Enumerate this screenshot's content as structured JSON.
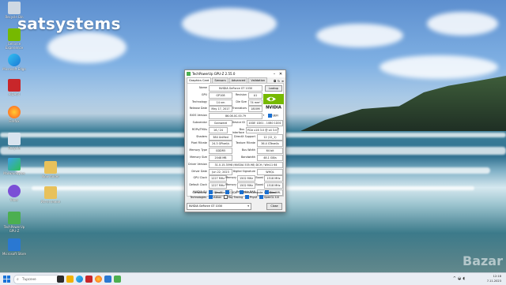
{
  "watermark": "satsystems",
  "brand_logo": "Bazar",
  "desktop_icons": [
    {
      "label": "Recycle Bin",
      "icon": "recycle-bin-icon"
    },
    {
      "label": "GeForce Experience",
      "icon": "nvidia-icon"
    },
    {
      "label": "Microsoft Edge",
      "icon": "edge-icon"
    },
    {
      "label": "AIDA64",
      "icon": "aida64-icon"
    },
    {
      "label": "Firefox",
      "icon": "firefox-icon"
    },
    {
      "label": "Recycle",
      "icon": "app-icon"
    },
    {
      "label": "Malwarebytes",
      "icon": "malwarebytes-icon"
    },
    {
      "label": "Viber",
      "icon": "viber-icon"
    },
    {
      "label": "Skype",
      "icon": "skype-icon"
    },
    {
      "label": "TechPowerUp GPU-Z",
      "icon": "gpuz-icon"
    },
    {
      "label": "Microsoft Store",
      "icon": "store-icon"
    }
  ],
  "desktop_folders": [
    {
      "label": "New folder"
    },
    {
      "label": "Изтегляния"
    }
  ],
  "gpuz": {
    "title": "TechPowerUp GPU-Z 2.55.0",
    "tabs": [
      "Graphics Card",
      "Sensors",
      "Advanced",
      "Validation"
    ],
    "lookup_label": "Lookup",
    "rows": [
      {
        "label": "Name",
        "values": [
          "NVIDIA GeForce GT 1030"
        ]
      },
      {
        "label": "GPU",
        "values": [
          "GP108",
          "Revision",
          "A1"
        ]
      },
      {
        "label": "Technology",
        "values": [
          "14 nm",
          "Die Size",
          "74 mm²"
        ]
      },
      {
        "label": "Release Date",
        "values": [
          "May 17, 2017",
          "Transistors",
          "1800M"
        ]
      },
      {
        "label": "BIOS Version",
        "values": [
          "86.08.0C.00.79",
          "UEFI"
        ]
      },
      {
        "label": "Subvendor",
        "values": [
          "Gainward",
          "Device ID",
          "10DE 1D01 - 10B0 1D01"
        ]
      },
      {
        "label": "ROPs/TMUs",
        "values": [
          "16 / 24",
          "Bus Interface",
          "PCIe x16 3.0 @ x4 3.0"
        ]
      },
      {
        "label": "Shaders",
        "values": [
          "384 Unified",
          "DirectX Support",
          "12 (12_1)"
        ]
      },
      {
        "label": "Pixel Fillrate",
        "values": [
          "24.3 GPixel/s",
          "Texture Fillrate",
          "36.4 GTexel/s"
        ]
      },
      {
        "label": "Memory Type",
        "values": [
          "GDDR5",
          "Bus Width",
          "64 bit"
        ]
      },
      {
        "label": "Memory Size",
        "values": [
          "2048 MB",
          "Bandwidth",
          "48.1 GB/s"
        ]
      },
      {
        "label": "Driver Version",
        "values": [
          "31.0.15.3598 (NVIDIA 535.98) DCH / Win11 64"
        ]
      },
      {
        "label": "Driver Date",
        "values": [
          "Jun 22, 2023",
          "Digital Signature",
          "WHQL"
        ]
      },
      {
        "label": "GPU Clock",
        "values": [
          "1227 MHz",
          "Memory",
          "1502 MHz",
          "Boost",
          "1518 MHz"
        ]
      },
      {
        "label": "Default Clock",
        "values": [
          "1227 MHz",
          "Memory",
          "1502 MHz",
          "Boost",
          "1518 MHz"
        ]
      },
      {
        "label": "NVIDIA SLI",
        "values": [
          "Disabled",
          "Resizable BAR",
          "Disabled"
        ]
      }
    ],
    "computing_label": "Computing",
    "computing": [
      {
        "label": "OpenCL",
        "checked": true
      },
      {
        "label": "CUDA",
        "checked": true
      },
      {
        "label": "DirectCompute",
        "checked": true
      },
      {
        "label": "DirectML",
        "checked": true
      }
    ],
    "technologies_label": "Technologies",
    "technologies": [
      {
        "label": "Vulkan",
        "checked": true
      },
      {
        "label": "Ray Tracing",
        "checked": false
      },
      {
        "label": "PhysX",
        "checked": true
      },
      {
        "label": "OpenGL 4.6",
        "checked": true
      }
    ],
    "selected_gpu": "NVIDIA GeForce GT 1030",
    "close_label": "Close"
  },
  "taskbar": {
    "search_placeholder": "Търсене",
    "time": "12:18",
    "date": "7.11.2023"
  },
  "colors": {
    "nvidia_green": "#76b900",
    "accent": "#1a6fd0"
  }
}
